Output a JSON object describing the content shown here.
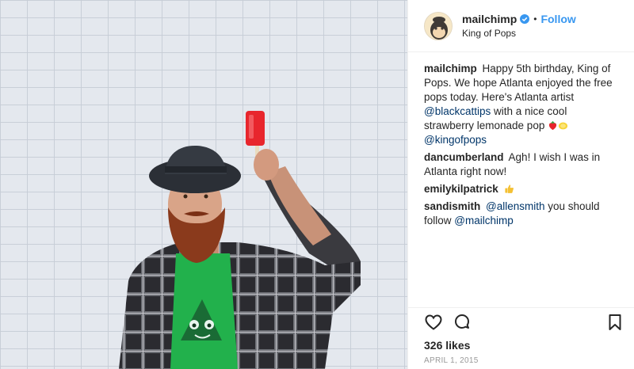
{
  "header": {
    "username": "mailchimp",
    "separator": "•",
    "follow_label": "Follow",
    "location": "King of Pops",
    "avatar_icon": "mailchimp-freddie-logo",
    "verified_icon": "verified-badge-icon",
    "verified_color": "#3897f0"
  },
  "comments": [
    {
      "user": "mailchimp",
      "text_1": "Happy 5th birthday, King of Pops. We hope Atlanta enjoyed the free pops today. Here's Atlanta artist ",
      "mention_1": "@blackcattips",
      "text_2": " with a nice cool strawberry lemonade pop ",
      "emoji": [
        "strawberry-emoji",
        "lemon-emoji"
      ],
      "mention_2": "@kingofpops"
    },
    {
      "user": "dancumberland",
      "text": "Agh! I wish I was in Atlanta right now!"
    },
    {
      "user": "emilykilpatrick",
      "emoji": "thumbs-up-emoji"
    },
    {
      "user": "sandismith",
      "mention_1": "@allensmith",
      "text": " you should follow ",
      "mention_2": "@mailchimp"
    }
  ],
  "actions": {
    "like_icon": "heart-icon",
    "comment_icon": "comment-icon",
    "save_icon": "bookmark-icon"
  },
  "likes": "326 likes",
  "date": "APRIL 1, 2015",
  "colors": {
    "link": "#003569",
    "follow": "#3897f0",
    "border": "#efefef",
    "date": "#999999",
    "popsicle": "#e8262d"
  }
}
